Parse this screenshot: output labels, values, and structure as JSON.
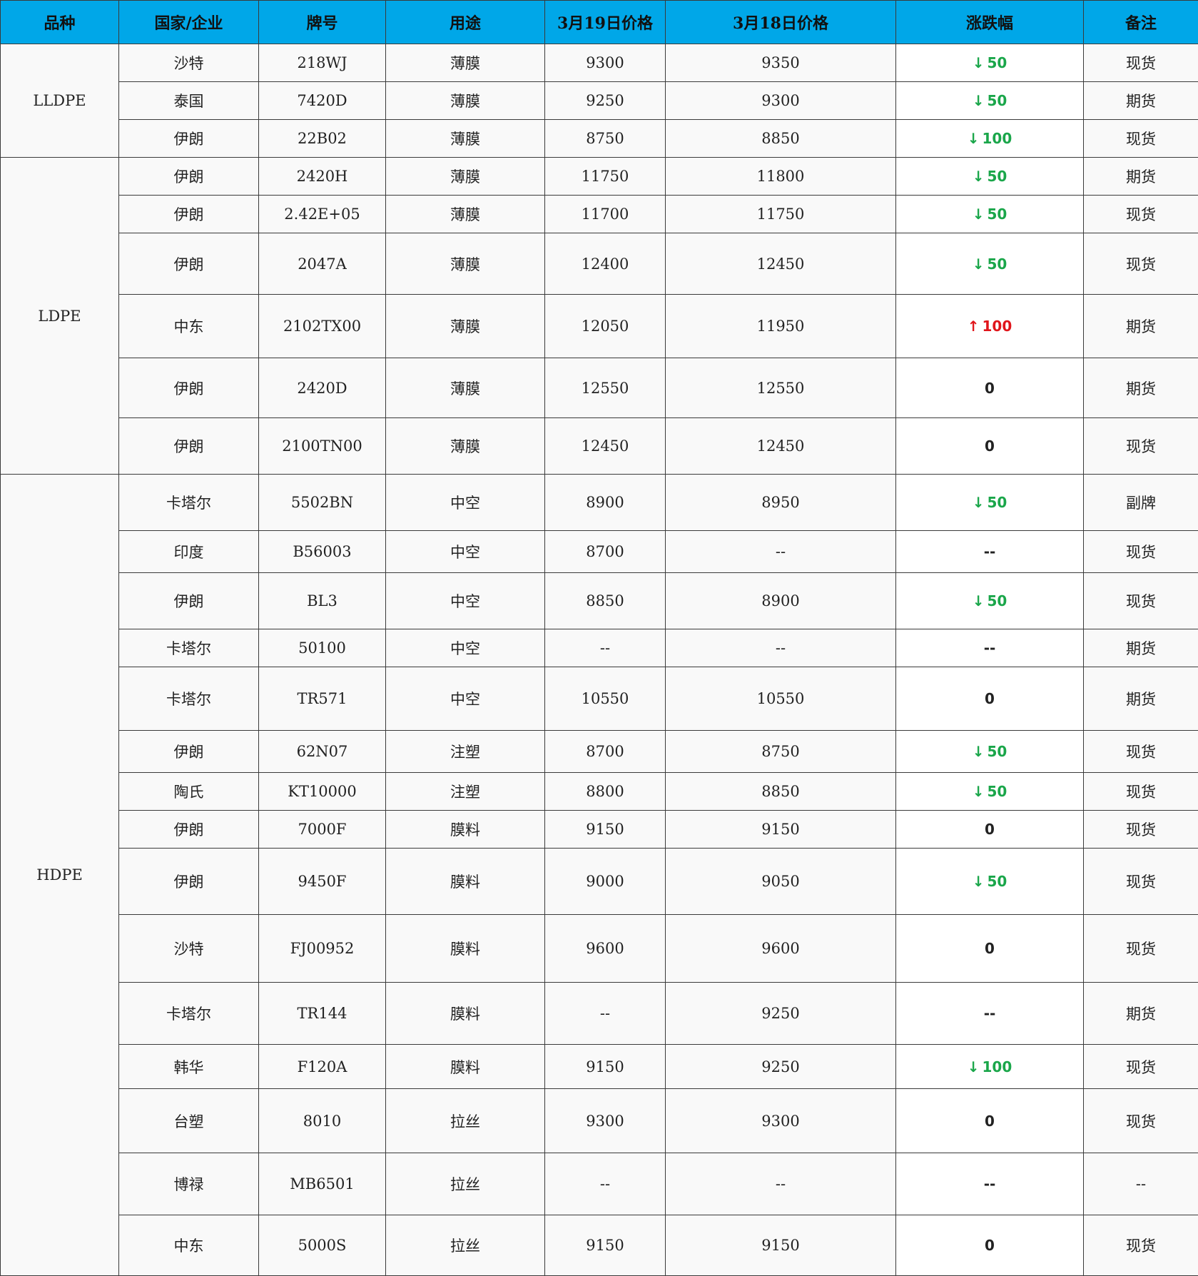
{
  "headers": {
    "variety": "品种",
    "company": "国家/企业",
    "grade": "牌号",
    "usage": "用途",
    "price_today": "3月19日价格",
    "price_prev": "3月18日价格",
    "change": "涨跌幅",
    "remark": "备注"
  },
  "colors": {
    "header_bg": "#00a7e8",
    "down": "#1aa64a",
    "up": "#e0151b"
  },
  "icons": {
    "down": "arrow-down-icon",
    "up": "arrow-up-icon"
  },
  "groups": [
    {
      "variety": "LLDPE",
      "rows": [
        {
          "company": "沙特",
          "grade": "218WJ",
          "usage": "薄膜",
          "price_today": "9300",
          "price_prev": "9350",
          "direction": "down",
          "arrow": "↓",
          "change": "50",
          "remark": "现货"
        },
        {
          "company": "泰国",
          "grade": "7420D",
          "usage": "薄膜",
          "price_today": "9250",
          "price_prev": "9300",
          "direction": "down",
          "arrow": "↓",
          "change": "50",
          "remark": "期货"
        },
        {
          "company": "伊朗",
          "grade": "22B02",
          "usage": "薄膜",
          "price_today": "8750",
          "price_prev": "8850",
          "direction": "down",
          "arrow": "↓",
          "change": "100",
          "remark": "现货"
        }
      ]
    },
    {
      "variety": "LDPE",
      "rows": [
        {
          "company": "伊朗",
          "grade": "2420H",
          "usage": "薄膜",
          "price_today": "11750",
          "price_prev": "11800",
          "direction": "down",
          "arrow": "↓",
          "change": "50",
          "remark": "期货"
        },
        {
          "company": "伊朗",
          "grade": "2.42E+05",
          "usage": "薄膜",
          "price_today": "11700",
          "price_prev": "11750",
          "direction": "down",
          "arrow": "↓",
          "change": "50",
          "remark": "现货"
        },
        {
          "company": "伊朗",
          "grade": "2047A",
          "usage": "薄膜",
          "price_today": "12400",
          "price_prev": "12450",
          "direction": "down",
          "arrow": "↓",
          "change": "50",
          "remark": "现货"
        },
        {
          "company": "中东",
          "grade": "2102TX00",
          "usage": "薄膜",
          "price_today": "12050",
          "price_prev": "11950",
          "direction": "up",
          "arrow": "↑",
          "change": "100",
          "remark": "期货"
        },
        {
          "company": "伊朗",
          "grade": "2420D",
          "usage": "薄膜",
          "price_today": "12550",
          "price_prev": "12550",
          "direction": "flat",
          "arrow": "",
          "change": "0",
          "remark": "期货"
        },
        {
          "company": "伊朗",
          "grade": "2100TN00",
          "usage": "薄膜",
          "price_today": "12450",
          "price_prev": "12450",
          "direction": "flat",
          "arrow": "",
          "change": "0",
          "remark": "现货"
        }
      ]
    },
    {
      "variety": "HDPE",
      "rows": [
        {
          "company": "卡塔尔",
          "grade": "5502BN",
          "usage": "中空",
          "price_today": "8900",
          "price_prev": "8950",
          "direction": "down",
          "arrow": "↓",
          "change": "50",
          "remark": "副牌"
        },
        {
          "company": "印度",
          "grade": "B56003",
          "usage": "中空",
          "price_today": "8700",
          "price_prev": "--",
          "direction": "none",
          "arrow": "",
          "change": "--",
          "remark": "现货"
        },
        {
          "company": "伊朗",
          "grade": "BL3",
          "usage": "中空",
          "price_today": "8850",
          "price_prev": "8900",
          "direction": "down",
          "arrow": "↓",
          "change": "50",
          "remark": "现货"
        },
        {
          "company": "卡塔尔",
          "grade": "50100",
          "usage": "中空",
          "price_today": "--",
          "price_prev": "--",
          "direction": "none",
          "arrow": "",
          "change": "--",
          "remark": "期货"
        },
        {
          "company": "卡塔尔",
          "grade": "TR571",
          "usage": "中空",
          "price_today": "10550",
          "price_prev": "10550",
          "direction": "flat",
          "arrow": "",
          "change": "0",
          "remark": "期货"
        },
        {
          "company": "伊朗",
          "grade": "62N07",
          "usage": "注塑",
          "price_today": "8700",
          "price_prev": "8750",
          "direction": "down",
          "arrow": "↓",
          "change": "50",
          "remark": "现货"
        },
        {
          "company": "陶氏",
          "grade": "KT10000",
          "usage": "注塑",
          "price_today": "8800",
          "price_prev": "8850",
          "direction": "down",
          "arrow": "↓",
          "change": "50",
          "remark": "现货"
        },
        {
          "company": "伊朗",
          "grade": "7000F",
          "usage": "膜料",
          "price_today": "9150",
          "price_prev": "9150",
          "direction": "flat",
          "arrow": "",
          "change": "0",
          "remark": "现货"
        },
        {
          "company": "伊朗",
          "grade": "9450F",
          "usage": "膜料",
          "price_today": "9000",
          "price_prev": "9050",
          "direction": "down",
          "arrow": "↓",
          "change": "50",
          "remark": "现货"
        },
        {
          "company": "沙特",
          "grade": "FJ00952",
          "usage": "膜料",
          "price_today": "9600",
          "price_prev": "9600",
          "direction": "flat",
          "arrow": "",
          "change": "0",
          "remark": "现货"
        },
        {
          "company": "卡塔尔",
          "grade": "TR144",
          "usage": "膜料",
          "price_today": "--",
          "price_prev": "9250",
          "direction": "none",
          "arrow": "",
          "change": "--",
          "remark": "期货"
        },
        {
          "company": "韩华",
          "grade": "F120A",
          "usage": "膜料",
          "price_today": "9150",
          "price_prev": "9250",
          "direction": "down",
          "arrow": "↓",
          "change": "100",
          "remark": "现货"
        },
        {
          "company": "台塑",
          "grade": "8010",
          "usage": "拉丝",
          "price_today": "9300",
          "price_prev": "9300",
          "direction": "flat",
          "arrow": "",
          "change": "0",
          "remark": "现货"
        },
        {
          "company": "博禄",
          "grade": "MB6501",
          "usage": "拉丝",
          "price_today": "--",
          "price_prev": "--",
          "direction": "none",
          "arrow": "",
          "change": "--",
          "remark": "--"
        },
        {
          "company": "中东",
          "grade": "5000S",
          "usage": "拉丝",
          "price_today": "9150",
          "price_prev": "9150",
          "direction": "flat",
          "arrow": "",
          "change": "0",
          "remark": "现货"
        }
      ]
    }
  ]
}
